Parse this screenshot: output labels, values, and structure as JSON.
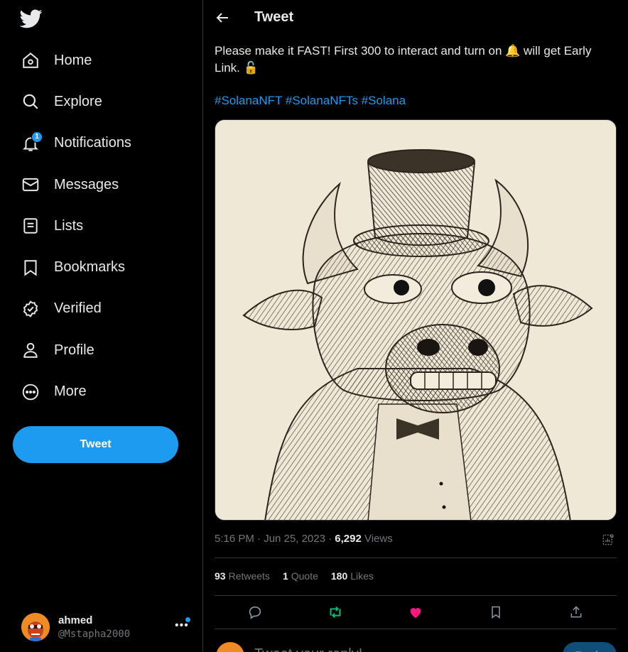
{
  "sidebar": {
    "logo_icon": "twitter-bird-icon",
    "items": [
      {
        "label": "Home",
        "icon": "home-icon"
      },
      {
        "label": "Explore",
        "icon": "search-icon"
      },
      {
        "label": "Notifications",
        "icon": "bell-icon",
        "badge": "1"
      },
      {
        "label": "Messages",
        "icon": "envelope-icon"
      },
      {
        "label": "Lists",
        "icon": "list-icon"
      },
      {
        "label": "Bookmarks",
        "icon": "bookmark-icon"
      },
      {
        "label": "Verified",
        "icon": "verified-icon"
      },
      {
        "label": "Profile",
        "icon": "person-icon"
      },
      {
        "label": "More",
        "icon": "more-circle-icon"
      }
    ],
    "tweet_button": "Tweet",
    "account": {
      "name": "ahmed",
      "handle": "@Mstapha2000"
    }
  },
  "header": {
    "title": "Tweet"
  },
  "tweet": {
    "text_1": "Please make it FAST! First 300 to interact and turn on ",
    "emoji_bell": "🔔",
    "text_2": " will get Early Link. ",
    "emoji_lock": "🔓",
    "hashtags": [
      "#SolanaNFT",
      "#SolanaNFTs",
      "#Solana"
    ],
    "time": "5:16 PM · Jun 25, 2023 · ",
    "views_count": "6,292",
    "views_label": " Views",
    "retweets_count": "93",
    "retweets_label": "Retweets",
    "quotes_count": "1",
    "quotes_label": "Quote",
    "likes_count": "180",
    "likes_label": "Likes"
  },
  "reply": {
    "placeholder": "Tweet your reply!",
    "button": "Reply"
  },
  "colors": {
    "accent": "#1d9bf0",
    "retweet": "#00ba7c",
    "like": "#f91880",
    "background": "#000000",
    "muted": "#71767b"
  }
}
